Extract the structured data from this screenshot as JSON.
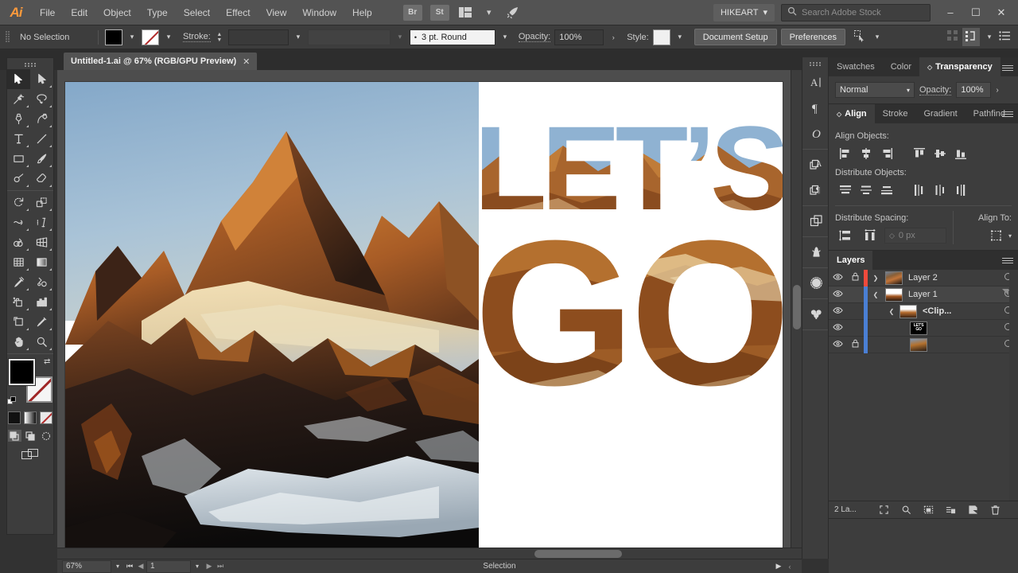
{
  "app": {
    "logo": "Ai",
    "menus": [
      "File",
      "Edit",
      "Object",
      "Type",
      "Select",
      "Effect",
      "View",
      "Window",
      "Help"
    ],
    "bridge_icon_label": "Br",
    "stock_icon_label": "St",
    "workspace": "HIKEART",
    "stock_search_placeholder": "Search Adobe Stock",
    "window_buttons": {
      "minimize": "–",
      "maximize": "☐",
      "close": "✕"
    }
  },
  "control_bar": {
    "selection_status": "No Selection",
    "fill_color": "#000000",
    "stroke_color": "none",
    "stroke_label": "Stroke:",
    "stroke_weight": "",
    "brush_definition": "3 pt. Round",
    "opacity_label": "Opacity:",
    "opacity_value": "100%",
    "style_label": "Style:",
    "document_setup": "Document Setup",
    "preferences": "Preferences"
  },
  "document_tab": {
    "title": "Untitled-1.ai @ 67% (RGB/GPU Preview)",
    "close": "✕"
  },
  "toolbar": {
    "tools": [
      {
        "name": "selection-tool",
        "active": true
      },
      {
        "name": "direct-selection-tool",
        "active": false
      },
      {
        "name": "magic-wand-tool",
        "active": false
      },
      {
        "name": "lasso-tool",
        "active": false
      },
      {
        "name": "pen-tool",
        "active": false
      },
      {
        "name": "curvature-tool",
        "active": false
      },
      {
        "name": "type-tool",
        "active": false
      },
      {
        "name": "line-segment-tool",
        "active": false
      },
      {
        "name": "rectangle-tool",
        "active": false
      },
      {
        "name": "paintbrush-tool",
        "active": false
      },
      {
        "name": "shaper-tool",
        "active": false
      },
      {
        "name": "eraser-tool",
        "active": false
      },
      {
        "name": "rotate-tool",
        "active": false
      },
      {
        "name": "scale-tool",
        "active": false
      },
      {
        "name": "width-tool",
        "active": false
      },
      {
        "name": "free-transform-tool",
        "active": false
      },
      {
        "name": "shape-builder-tool",
        "active": false
      },
      {
        "name": "perspective-grid-tool",
        "active": false
      },
      {
        "name": "mesh-tool",
        "active": false
      },
      {
        "name": "gradient-tool",
        "active": false
      },
      {
        "name": "eyedropper-tool",
        "active": false
      },
      {
        "name": "blend-tool",
        "active": false
      },
      {
        "name": "symbol-sprayer-tool",
        "active": false
      },
      {
        "name": "column-graph-tool",
        "active": false
      },
      {
        "name": "artboard-tool",
        "active": false
      },
      {
        "name": "slice-tool",
        "active": false
      },
      {
        "name": "hand-tool",
        "active": false
      },
      {
        "name": "zoom-tool",
        "active": false
      }
    ],
    "fill_color": "#000000",
    "stroke_color": "none"
  },
  "canvas": {
    "poster_line1": "LET’S",
    "poster_line2": "GO",
    "zoom": "67%"
  },
  "status_bar": {
    "zoom": "67%",
    "artboard": "1",
    "status": "Selection"
  },
  "icon_strip": [
    {
      "name": "character-panel-icon",
      "glyph": "A"
    },
    {
      "name": "paragraph-panel-icon",
      "glyph": "¶"
    },
    {
      "name": "glyphs-panel-icon",
      "glyph": "O"
    },
    {
      "name": "character-styles-panel-icon",
      "glyph": "A"
    },
    {
      "name": "paragraph-styles-panel-icon",
      "glyph": "¶"
    },
    {
      "name": "artboards-panel-icon",
      "glyph": "⧉"
    },
    {
      "name": "brushes-panel-icon",
      "glyph": "☘"
    },
    {
      "name": "symbols-panel-icon",
      "glyph": "◌"
    },
    {
      "name": "graphic-styles-panel-icon",
      "glyph": "♣"
    }
  ],
  "transparency_panel": {
    "tabs": [
      {
        "label": "Swatches",
        "active": false
      },
      {
        "label": "Color",
        "active": false
      },
      {
        "label": "Transparency",
        "active": true
      }
    ],
    "blend_mode": "Normal",
    "opacity_label": "Opacity:",
    "opacity_value": "100%"
  },
  "align_panel": {
    "tabs": [
      {
        "label": "Align",
        "active": true
      },
      {
        "label": "Stroke",
        "active": false
      },
      {
        "label": "Gradient",
        "active": false
      },
      {
        "label": "Pathfind",
        "active": false
      }
    ],
    "align_objects_label": "Align Objects:",
    "align_buttons": [
      "align-left-icon",
      "align-horizontal-center-icon",
      "align-right-icon",
      "align-top-icon",
      "align-vertical-center-icon",
      "align-bottom-icon"
    ],
    "distribute_objects_label": "Distribute Objects:",
    "distribute_buttons": [
      "distribute-top-icon",
      "distribute-vertical-center-icon",
      "distribute-bottom-icon",
      "distribute-left-icon",
      "distribute-horizontal-center-icon",
      "distribute-right-icon"
    ],
    "distribute_spacing_label": "Distribute Spacing:",
    "spacing_buttons": [
      "vertical-distribute-space-icon",
      "horizontal-distribute-space-icon"
    ],
    "spacing_value": "0 px",
    "align_to_label": "Align To:",
    "align_to_icon": "align-to-selection-icon"
  },
  "layers_panel": {
    "title": "Layers",
    "rows": [
      {
        "name": "Layer 2",
        "visible": true,
        "locked": true,
        "color": "#ef4a3c",
        "expander": "›",
        "indent": 0,
        "thumb": "th-rock",
        "selected": false
      },
      {
        "name": "Layer 1",
        "visible": true,
        "locked": false,
        "color": "#4a7fd4",
        "expander": "⌄",
        "indent": 0,
        "thumb": "th-rock2",
        "selected": true
      },
      {
        "name": "<Clip...",
        "visible": true,
        "locked": false,
        "color": "#4a7fd4",
        "expander": "⌄",
        "indent": 1,
        "thumb": "th-clip",
        "selected": false
      },
      {
        "name": "",
        "visible": true,
        "locked": false,
        "color": "#4a7fd4",
        "expander": "",
        "indent": 2,
        "thumb": "th-text",
        "selected": false
      },
      {
        "name": "",
        "visible": true,
        "locked": true,
        "color": "#4a7fd4",
        "expander": "",
        "indent": 2,
        "thumb": "th-photo",
        "selected": false
      }
    ],
    "count_label": "2 La...",
    "footer_icons": [
      "locate-object-icon",
      "release-to-layers-icon",
      "make-clipping-mask-icon",
      "create-new-sublayer-icon",
      "create-new-layer-icon",
      "delete-selection-icon"
    ],
    "layer_thumb_text": "LET'S GO"
  }
}
